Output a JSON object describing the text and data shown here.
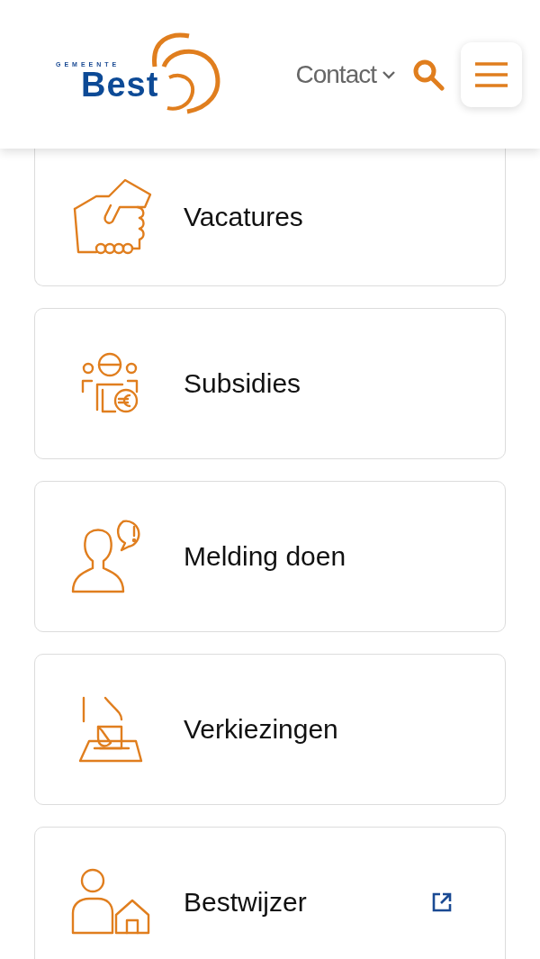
{
  "header": {
    "logo": {
      "small": "GEMEENTE",
      "big": "Best"
    },
    "contact": "Contact"
  },
  "cards": [
    {
      "label": "Vacatures",
      "external": false
    },
    {
      "label": "Subsidies",
      "external": false
    },
    {
      "label": "Melding doen",
      "external": false
    },
    {
      "label": "Verkiezingen",
      "external": false
    },
    {
      "label": "Bestwijzer",
      "external": true
    }
  ]
}
